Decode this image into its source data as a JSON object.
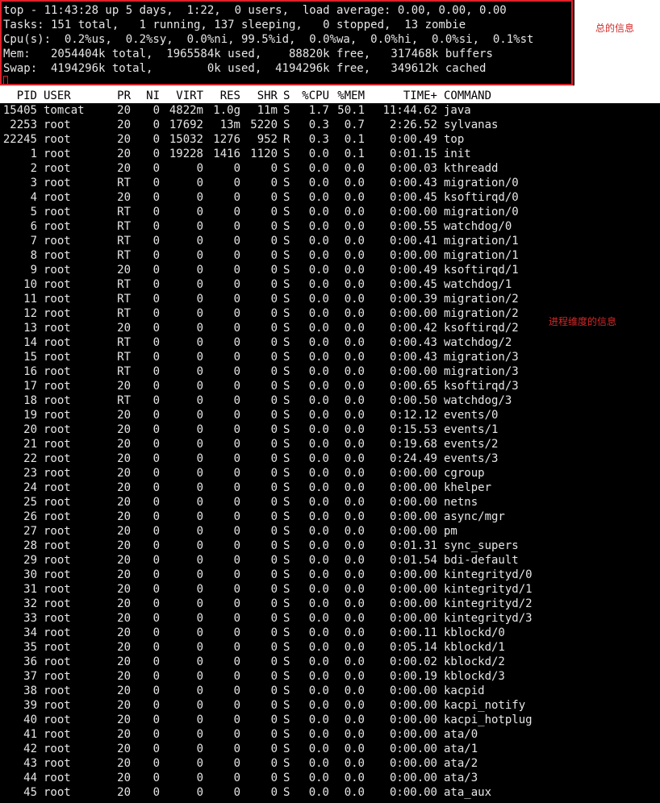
{
  "summary": {
    "lines": [
      "top - 11:43:28 up 5 days,  1:22,  0 users,  load average: 0.00, 0.00, 0.00",
      "Tasks: 151 total,   1 running, 137 sleeping,   0 stopped,  13 zombie",
      "Cpu(s):  0.2%us,  0.2%sy,  0.0%ni, 99.5%id,  0.0%wa,  0.0%hi,  0.0%si,  0.1%st",
      "Mem:   2054404k total,  1965584k used,    88820k free,   317468k buffers",
      "Swap:  4194296k total,        0k used,  4194296k free,   349612k cached"
    ],
    "annotation": "总的信息",
    "box_color": "#e0202a"
  },
  "process_table": {
    "headers": [
      "PID",
      "USER",
      "PR",
      "NI",
      "VIRT",
      "RES",
      "SHR",
      "S",
      "%CPU",
      "%MEM",
      "TIME+",
      "COMMAND"
    ],
    "annotation": "进程维度的信息",
    "rows": [
      [
        "15405",
        "tomcat",
        "20",
        "0",
        "4822m",
        "1.0g",
        "11m",
        "S",
        "1.7",
        "50.1",
        "11:44.62",
        "java"
      ],
      [
        "2253",
        "root",
        "20",
        "0",
        "17692",
        "13m",
        "5220",
        "S",
        "0.3",
        "0.7",
        "2:26.52",
        "sylvanas"
      ],
      [
        "22245",
        "root",
        "20",
        "0",
        "15032",
        "1276",
        "952",
        "R",
        "0.3",
        "0.1",
        "0:00.49",
        "top"
      ],
      [
        "1",
        "root",
        "20",
        "0",
        "19228",
        "1416",
        "1120",
        "S",
        "0.0",
        "0.1",
        "0:01.15",
        "init"
      ],
      [
        "2",
        "root",
        "20",
        "0",
        "0",
        "0",
        "0",
        "S",
        "0.0",
        "0.0",
        "0:00.03",
        "kthreadd"
      ],
      [
        "3",
        "root",
        "RT",
        "0",
        "0",
        "0",
        "0",
        "S",
        "0.0",
        "0.0",
        "0:00.43",
        "migration/0"
      ],
      [
        "4",
        "root",
        "20",
        "0",
        "0",
        "0",
        "0",
        "S",
        "0.0",
        "0.0",
        "0:00.45",
        "ksoftirqd/0"
      ],
      [
        "5",
        "root",
        "RT",
        "0",
        "0",
        "0",
        "0",
        "S",
        "0.0",
        "0.0",
        "0:00.00",
        "migration/0"
      ],
      [
        "6",
        "root",
        "RT",
        "0",
        "0",
        "0",
        "0",
        "S",
        "0.0",
        "0.0",
        "0:00.55",
        "watchdog/0"
      ],
      [
        "7",
        "root",
        "RT",
        "0",
        "0",
        "0",
        "0",
        "S",
        "0.0",
        "0.0",
        "0:00.41",
        "migration/1"
      ],
      [
        "8",
        "root",
        "RT",
        "0",
        "0",
        "0",
        "0",
        "S",
        "0.0",
        "0.0",
        "0:00.00",
        "migration/1"
      ],
      [
        "9",
        "root",
        "20",
        "0",
        "0",
        "0",
        "0",
        "S",
        "0.0",
        "0.0",
        "0:00.49",
        "ksoftirqd/1"
      ],
      [
        "10",
        "root",
        "RT",
        "0",
        "0",
        "0",
        "0",
        "S",
        "0.0",
        "0.0",
        "0:00.45",
        "watchdog/1"
      ],
      [
        "11",
        "root",
        "RT",
        "0",
        "0",
        "0",
        "0",
        "S",
        "0.0",
        "0.0",
        "0:00.39",
        "migration/2"
      ],
      [
        "12",
        "root",
        "RT",
        "0",
        "0",
        "0",
        "0",
        "S",
        "0.0",
        "0.0",
        "0:00.00",
        "migration/2"
      ],
      [
        "13",
        "root",
        "20",
        "0",
        "0",
        "0",
        "0",
        "S",
        "0.0",
        "0.0",
        "0:00.42",
        "ksoftirqd/2"
      ],
      [
        "14",
        "root",
        "RT",
        "0",
        "0",
        "0",
        "0",
        "S",
        "0.0",
        "0.0",
        "0:00.43",
        "watchdog/2"
      ],
      [
        "15",
        "root",
        "RT",
        "0",
        "0",
        "0",
        "0",
        "S",
        "0.0",
        "0.0",
        "0:00.43",
        "migration/3"
      ],
      [
        "16",
        "root",
        "RT",
        "0",
        "0",
        "0",
        "0",
        "S",
        "0.0",
        "0.0",
        "0:00.00",
        "migration/3"
      ],
      [
        "17",
        "root",
        "20",
        "0",
        "0",
        "0",
        "0",
        "S",
        "0.0",
        "0.0",
        "0:00.65",
        "ksoftirqd/3"
      ],
      [
        "18",
        "root",
        "RT",
        "0",
        "0",
        "0",
        "0",
        "S",
        "0.0",
        "0.0",
        "0:00.50",
        "watchdog/3"
      ],
      [
        "19",
        "root",
        "20",
        "0",
        "0",
        "0",
        "0",
        "S",
        "0.0",
        "0.0",
        "0:12.12",
        "events/0"
      ],
      [
        "20",
        "root",
        "20",
        "0",
        "0",
        "0",
        "0",
        "S",
        "0.0",
        "0.0",
        "0:15.53",
        "events/1"
      ],
      [
        "21",
        "root",
        "20",
        "0",
        "0",
        "0",
        "0",
        "S",
        "0.0",
        "0.0",
        "0:19.68",
        "events/2"
      ],
      [
        "22",
        "root",
        "20",
        "0",
        "0",
        "0",
        "0",
        "S",
        "0.0",
        "0.0",
        "0:24.49",
        "events/3"
      ],
      [
        "23",
        "root",
        "20",
        "0",
        "0",
        "0",
        "0",
        "S",
        "0.0",
        "0.0",
        "0:00.00",
        "cgroup"
      ],
      [
        "24",
        "root",
        "20",
        "0",
        "0",
        "0",
        "0",
        "S",
        "0.0",
        "0.0",
        "0:00.00",
        "khelper"
      ],
      [
        "25",
        "root",
        "20",
        "0",
        "0",
        "0",
        "0",
        "S",
        "0.0",
        "0.0",
        "0:00.00",
        "netns"
      ],
      [
        "26",
        "root",
        "20",
        "0",
        "0",
        "0",
        "0",
        "S",
        "0.0",
        "0.0",
        "0:00.00",
        "async/mgr"
      ],
      [
        "27",
        "root",
        "20",
        "0",
        "0",
        "0",
        "0",
        "S",
        "0.0",
        "0.0",
        "0:00.00",
        "pm"
      ],
      [
        "28",
        "root",
        "20",
        "0",
        "0",
        "0",
        "0",
        "S",
        "0.0",
        "0.0",
        "0:01.31",
        "sync_supers"
      ],
      [
        "29",
        "root",
        "20",
        "0",
        "0",
        "0",
        "0",
        "S",
        "0.0",
        "0.0",
        "0:01.54",
        "bdi-default"
      ],
      [
        "30",
        "root",
        "20",
        "0",
        "0",
        "0",
        "0",
        "S",
        "0.0",
        "0.0",
        "0:00.00",
        "kintegrityd/0"
      ],
      [
        "31",
        "root",
        "20",
        "0",
        "0",
        "0",
        "0",
        "S",
        "0.0",
        "0.0",
        "0:00.00",
        "kintegrityd/1"
      ],
      [
        "32",
        "root",
        "20",
        "0",
        "0",
        "0",
        "0",
        "S",
        "0.0",
        "0.0",
        "0:00.00",
        "kintegrityd/2"
      ],
      [
        "33",
        "root",
        "20",
        "0",
        "0",
        "0",
        "0",
        "S",
        "0.0",
        "0.0",
        "0:00.00",
        "kintegrityd/3"
      ],
      [
        "34",
        "root",
        "20",
        "0",
        "0",
        "0",
        "0",
        "S",
        "0.0",
        "0.0",
        "0:00.11",
        "kblockd/0"
      ],
      [
        "35",
        "root",
        "20",
        "0",
        "0",
        "0",
        "0",
        "S",
        "0.0",
        "0.0",
        "0:05.14",
        "kblockd/1"
      ],
      [
        "36",
        "root",
        "20",
        "0",
        "0",
        "0",
        "0",
        "S",
        "0.0",
        "0.0",
        "0:00.02",
        "kblockd/2"
      ],
      [
        "37",
        "root",
        "20",
        "0",
        "0",
        "0",
        "0",
        "S",
        "0.0",
        "0.0",
        "0:00.19",
        "kblockd/3"
      ],
      [
        "38",
        "root",
        "20",
        "0",
        "0",
        "0",
        "0",
        "S",
        "0.0",
        "0.0",
        "0:00.00",
        "kacpid"
      ],
      [
        "39",
        "root",
        "20",
        "0",
        "0",
        "0",
        "0",
        "S",
        "0.0",
        "0.0",
        "0:00.00",
        "kacpi_notify"
      ],
      [
        "40",
        "root",
        "20",
        "0",
        "0",
        "0",
        "0",
        "S",
        "0.0",
        "0.0",
        "0:00.00",
        "kacpi_hotplug"
      ],
      [
        "41",
        "root",
        "20",
        "0",
        "0",
        "0",
        "0",
        "S",
        "0.0",
        "0.0",
        "0:00.00",
        "ata/0"
      ],
      [
        "42",
        "root",
        "20",
        "0",
        "0",
        "0",
        "0",
        "S",
        "0.0",
        "0.0",
        "0:00.00",
        "ata/1"
      ],
      [
        "43",
        "root",
        "20",
        "0",
        "0",
        "0",
        "0",
        "S",
        "0.0",
        "0.0",
        "0:00.00",
        "ata/2"
      ],
      [
        "44",
        "root",
        "20",
        "0",
        "0",
        "0",
        "0",
        "S",
        "0.0",
        "0.0",
        "0:00.00",
        "ata/3"
      ],
      [
        "45",
        "root",
        "20",
        "0",
        "0",
        "0",
        "0",
        "S",
        "0.0",
        "0.0",
        "0:00.00",
        "ata_aux"
      ]
    ]
  }
}
